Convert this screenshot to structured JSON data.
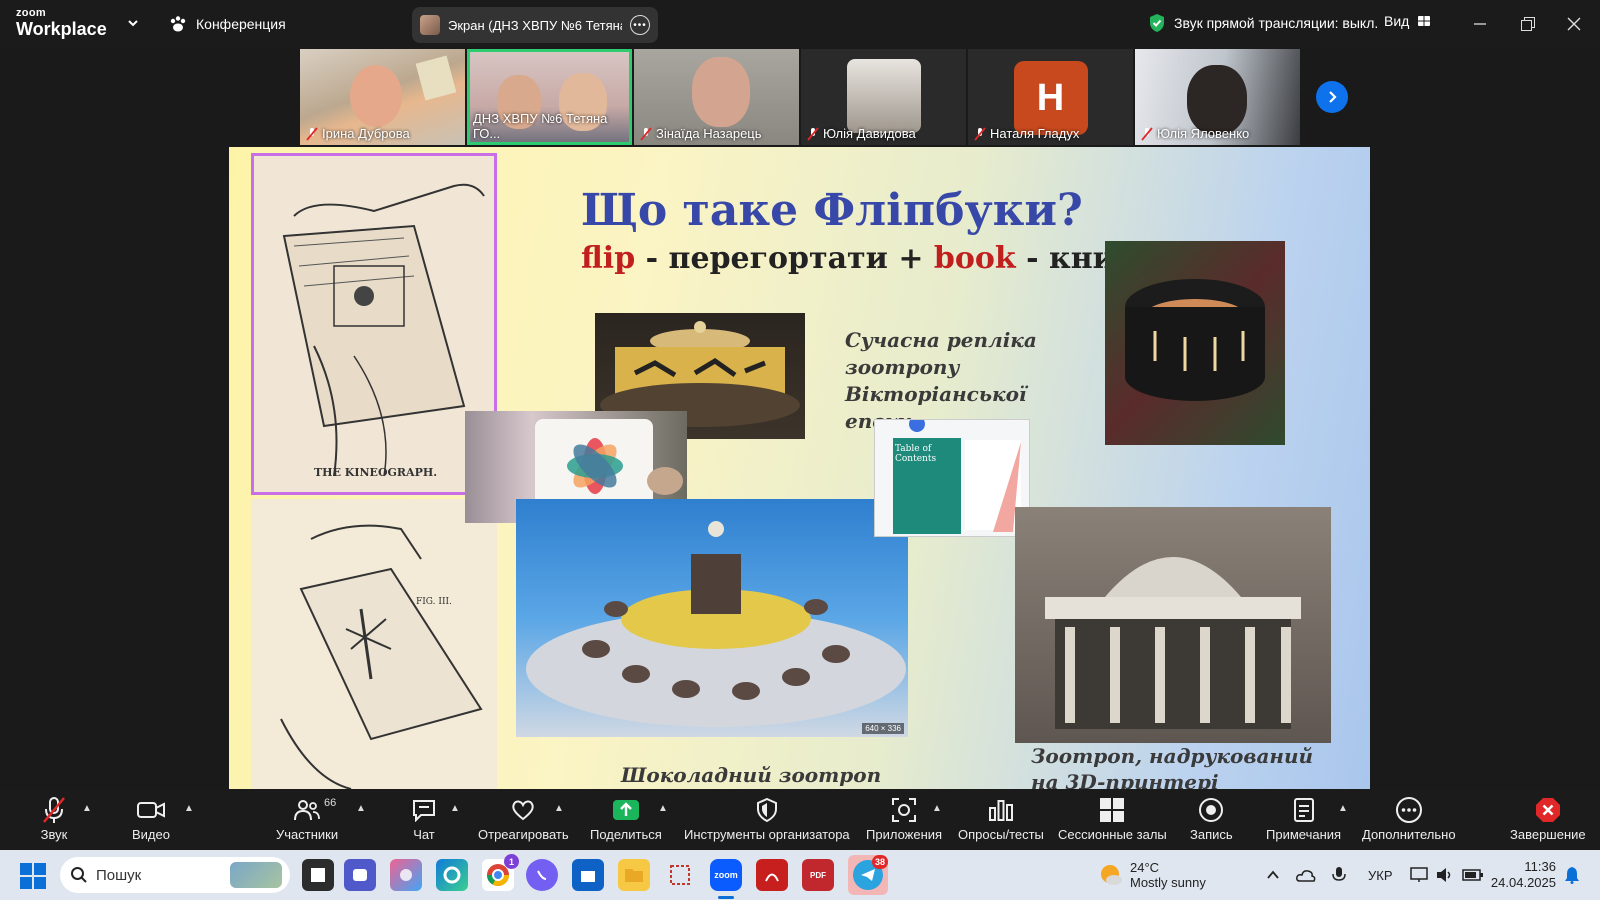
{
  "app": {
    "brand_small": "zoom",
    "brand": "Workplace",
    "conference_label": "Конференция",
    "screen_share_label": "Экран (ДНЗ ХВПУ №6 Тетяна Го",
    "live_sound_status": "Звук прямой трансляции: выкл.",
    "view_label": "Вид"
  },
  "participants": [
    {
      "name": "Ірина Дуброва"
    },
    {
      "name": "ДНЗ ХВПУ №6 Тетяна ГО..."
    },
    {
      "name": "Зінаїда Назарець"
    },
    {
      "name": "Юлія Давидова"
    },
    {
      "name": "Наталя Гладух",
      "initial": "H"
    },
    {
      "name": "Юлія Яловенко"
    }
  ],
  "slide": {
    "title": "Що таке Фліпбуки?",
    "sub_flip": "flip",
    "sub_mid": " - перегортати + ",
    "sub_book": "book",
    "sub_end": " - книга)",
    "kineograph_label": "THE KINEOGRAPH.",
    "fig_label": "FIG. III.",
    "caption_replica": "Сучасна репліка зоотропу Вікторіанської епохи",
    "caption_choco": "Шоколадний зоотроп",
    "caption_3d": "Зоотроп, надрукований на 3D-принтері",
    "img_size_label": "640 × 336",
    "toc_label": "Table of Contents"
  },
  "toolbar": {
    "audio": "Звук",
    "video": "Видео",
    "participants": "Участники",
    "participants_count": "66",
    "chat": "Чат",
    "react": "Отреагировать",
    "share": "Поделиться",
    "host_tools": "Инструменты организатора",
    "apps": "Приложения",
    "polls": "Опросы/тесты",
    "breakout": "Сессионные залы",
    "record": "Запись",
    "notes": "Примечания",
    "more": "Дополнительно",
    "end": "Завершение"
  },
  "taskbar": {
    "search_placeholder": "Пошук",
    "weather_temp": "24°C",
    "weather_desc": "Mostly sunny",
    "lang": "УКР",
    "time": "11:36",
    "date": "24.04.2025",
    "chrome_badge": "1",
    "telegram_badge": "38"
  },
  "colors": {
    "accent_blue": "#0e72ed",
    "active_green": "#2ecc71",
    "end_red": "#e02828",
    "title_blue": "#3848a8",
    "flip_red": "#c11e1e"
  }
}
